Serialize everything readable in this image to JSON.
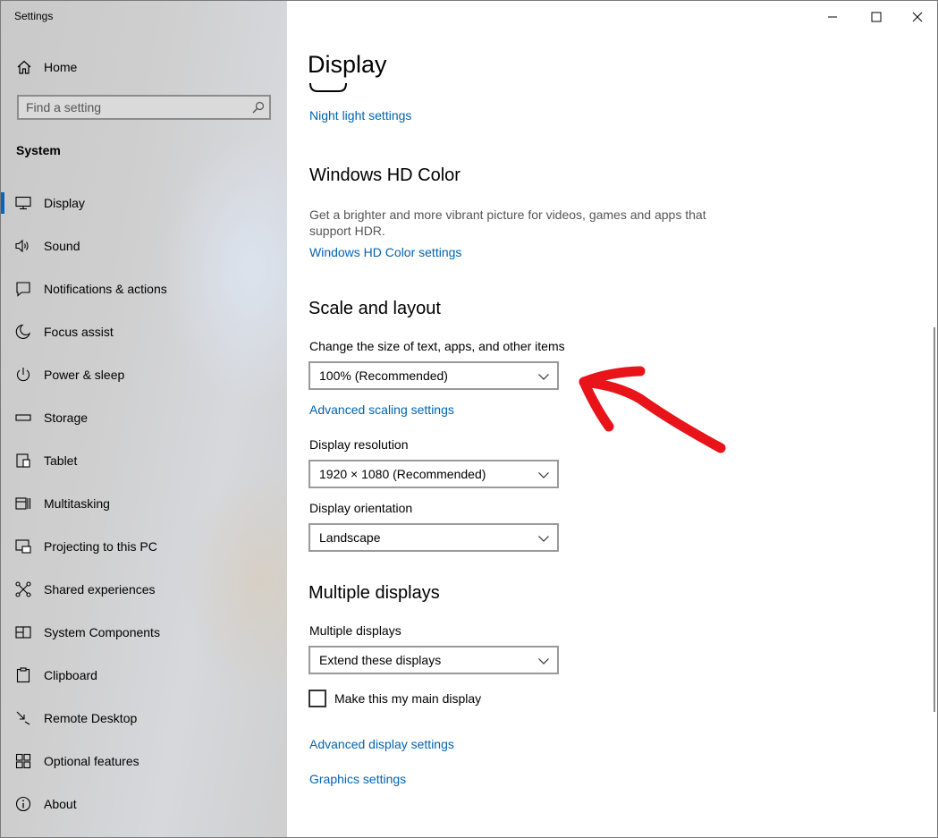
{
  "window": {
    "title": "Settings"
  },
  "sidebar": {
    "home_label": "Home",
    "search_placeholder": "Find a setting",
    "section_title": "System",
    "items": [
      {
        "label": "Display",
        "icon": "monitor-icon",
        "selected": true
      },
      {
        "label": "Sound",
        "icon": "speaker-icon"
      },
      {
        "label": "Notifications & actions",
        "icon": "notification-icon"
      },
      {
        "label": "Focus assist",
        "icon": "moon-icon"
      },
      {
        "label": "Power & sleep",
        "icon": "power-icon"
      },
      {
        "label": "Storage",
        "icon": "storage-icon"
      },
      {
        "label": "Tablet",
        "icon": "tablet-icon"
      },
      {
        "label": "Multitasking",
        "icon": "multitasking-icon"
      },
      {
        "label": "Projecting to this PC",
        "icon": "projecting-icon"
      },
      {
        "label": "Shared experiences",
        "icon": "share-icon"
      },
      {
        "label": "System Components",
        "icon": "components-icon"
      },
      {
        "label": "Clipboard",
        "icon": "clipboard-icon"
      },
      {
        "label": "Remote Desktop",
        "icon": "remote-desktop-icon"
      },
      {
        "label": "Optional features",
        "icon": "optional-features-icon"
      },
      {
        "label": "About",
        "icon": "info-icon"
      }
    ]
  },
  "main": {
    "page_title": "Display",
    "night_light_link": "Night light settings",
    "hd_color": {
      "heading": "Windows HD Color",
      "description": "Get a brighter and more vibrant picture for videos, games and apps that support HDR.",
      "link": "Windows HD Color settings"
    },
    "scale_layout": {
      "heading": "Scale and layout",
      "scale_label": "Change the size of text, apps, and other items",
      "scale_value": "100% (Recommended)",
      "advanced_scaling_link": "Advanced scaling settings",
      "resolution_label": "Display resolution",
      "resolution_value": "1920 × 1080 (Recommended)",
      "orientation_label": "Display orientation",
      "orientation_value": "Landscape"
    },
    "multiple_displays": {
      "heading": "Multiple displays",
      "label": "Multiple displays",
      "value": "Extend these displays",
      "main_display_checkbox_label": "Make this my main display",
      "main_display_checked": false
    },
    "advanced_display_link": "Advanced display settings",
    "graphics_link": "Graphics settings"
  },
  "colors": {
    "accent": "#0067c0",
    "link": "#0063b1",
    "annotation": "#e8141a"
  }
}
